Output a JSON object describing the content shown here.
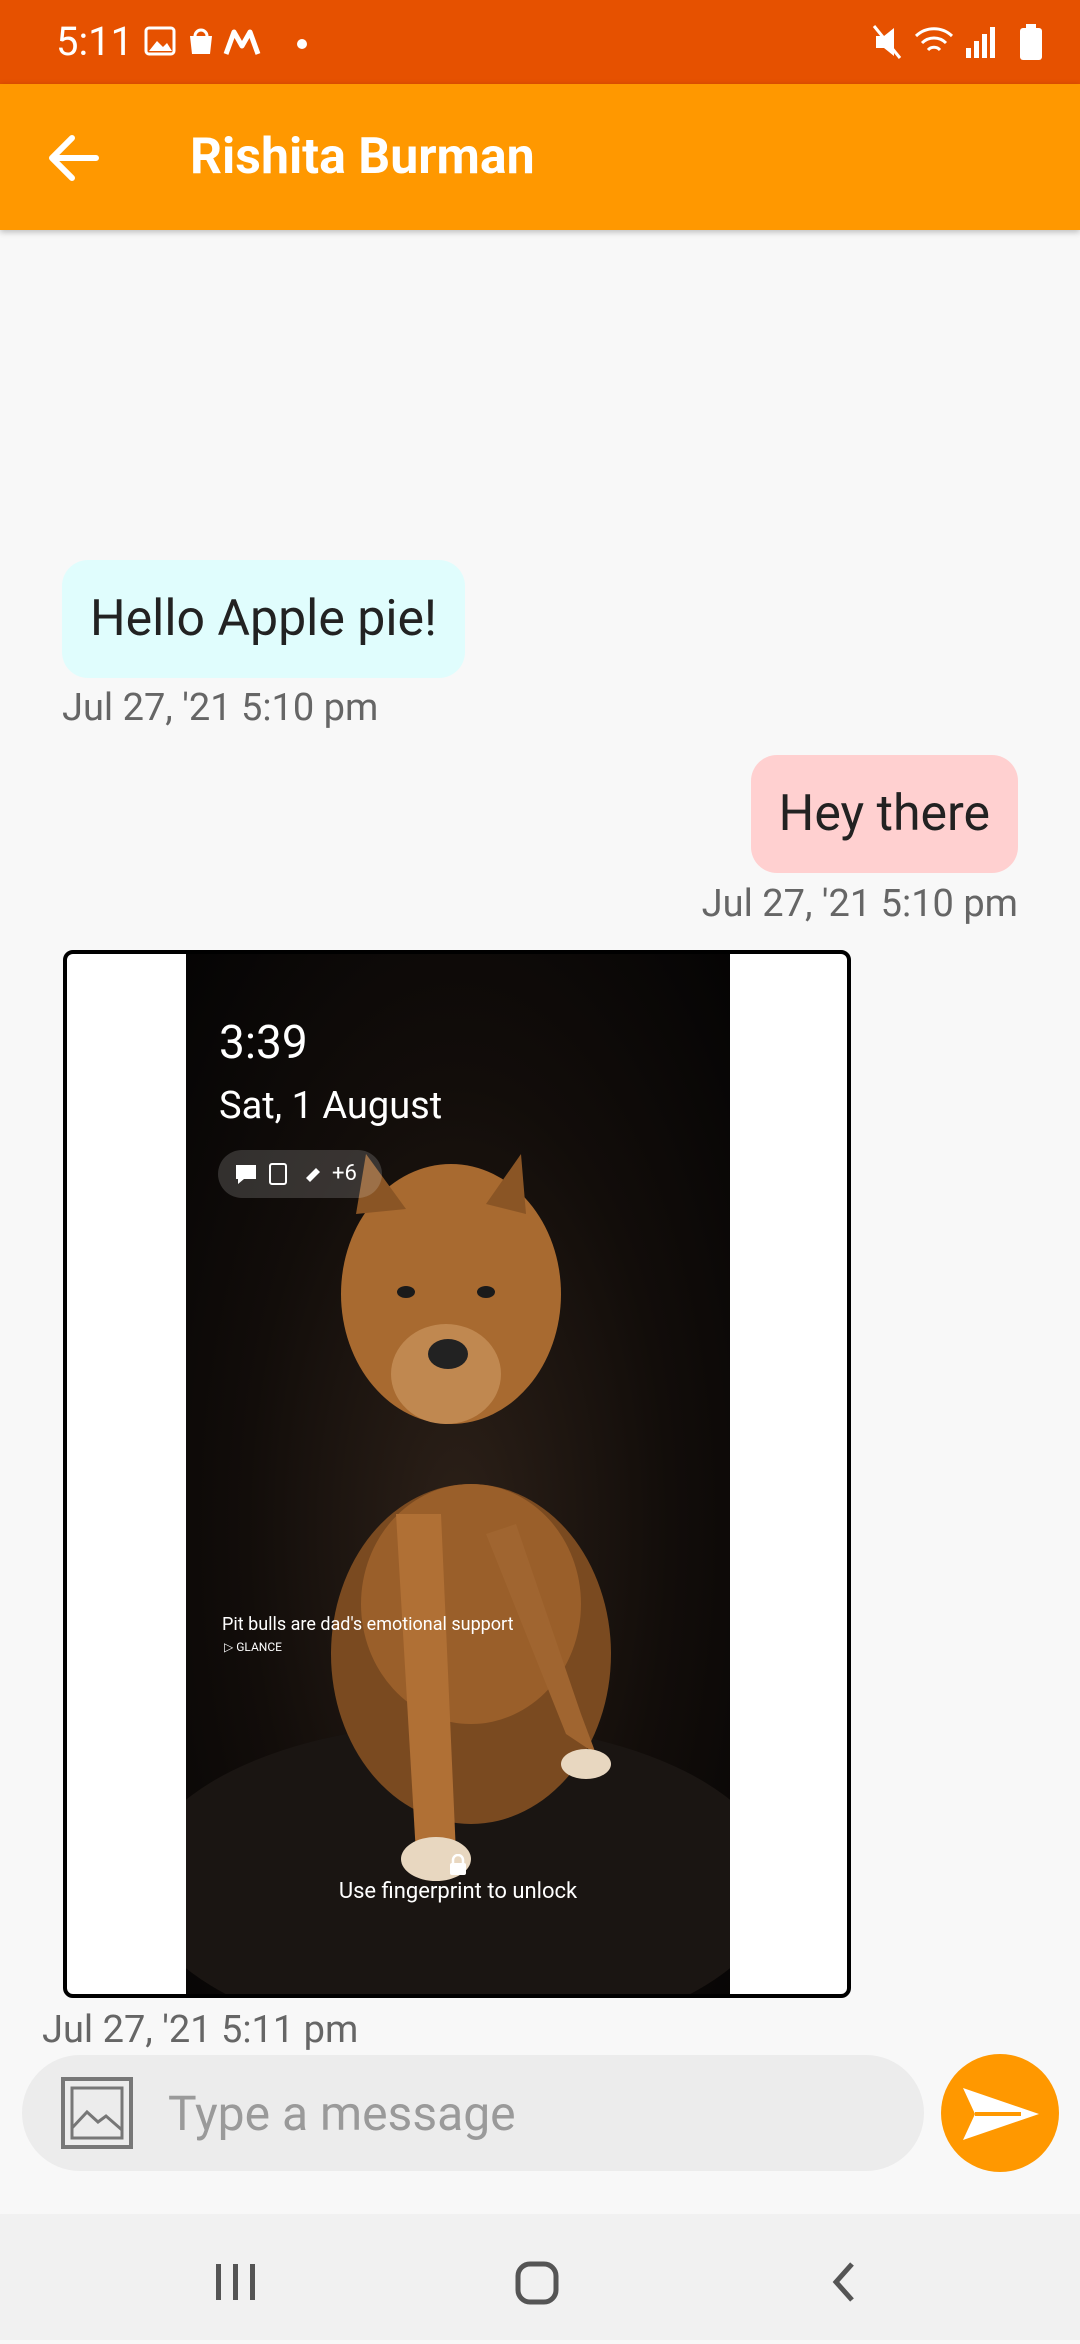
{
  "status_bar": {
    "time": "5:11"
  },
  "app_bar": {
    "title": "Rishita Burman"
  },
  "messages": [
    {
      "direction": "incoming",
      "text": "Hello Apple pie!",
      "timestamp": "Jul 27, '21 5:10 pm"
    },
    {
      "direction": "outgoing",
      "text": "Hey there",
      "timestamp": "Jul 27, '21 5:10 pm"
    },
    {
      "direction": "incoming",
      "type": "image",
      "timestamp": "Jul 27, '21 5:11 pm",
      "image_content": {
        "lock_time": "3:39",
        "lock_date": "Sat, 1 August",
        "notif_count": "+6",
        "caption": "Pit bulls are dad's emotional support",
        "glance_label": "GLANCE",
        "unlock_hint": "Use fingerprint to unlock"
      }
    }
  ],
  "composer": {
    "placeholder": "Type a message"
  },
  "colors": {
    "status_bar": "#e65100",
    "app_bar": "#ff9800",
    "incoming_bubble": "#e0fdfd",
    "outgoing_bubble": "#ffd0d0",
    "send_button": "#ff9800"
  }
}
